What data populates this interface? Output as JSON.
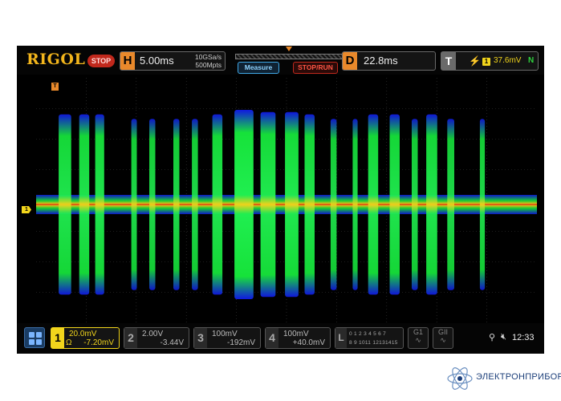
{
  "brand": {
    "logo_text": "RIGOL",
    "logo_color": "#f2b51c"
  },
  "status": {
    "run_state": "STOP",
    "run_state_color": "#c0281c"
  },
  "horizontal": {
    "letter": "H",
    "timebase": "5.00ms",
    "sample_rate": "10GSa/s",
    "memory_depth": "500Mpts"
  },
  "toolbar": {
    "measure_label": "Measure",
    "stop_run_label": "STOP/RUN"
  },
  "delay": {
    "letter": "D",
    "value": "22.8ms"
  },
  "trigger": {
    "letter": "T",
    "edge_icon": "rising-edge-icon",
    "source": "1",
    "level": "37.6mV",
    "mode": "N",
    "position_marker": "T"
  },
  "channel_marker": "1",
  "waveform": {
    "colors": {
      "low": "#1018e0",
      "mid": "#16e23a",
      "high": "#f0d21c",
      "peak": "#ff2010"
    },
    "bursts": [
      {
        "start": 0.045,
        "end": 0.07,
        "intensity": 0.8
      },
      {
        "start": 0.086,
        "end": 0.106,
        "intensity": 0.8
      },
      {
        "start": 0.118,
        "end": 0.136,
        "intensity": 0.8
      },
      {
        "start": 0.19,
        "end": 0.201,
        "intensity": 0.6
      },
      {
        "start": 0.226,
        "end": 0.238,
        "intensity": 0.6
      },
      {
        "start": 0.274,
        "end": 0.286,
        "intensity": 0.6
      },
      {
        "start": 0.311,
        "end": 0.323,
        "intensity": 0.6
      },
      {
        "start": 0.352,
        "end": 0.372,
        "intensity": 0.8
      },
      {
        "start": 0.396,
        "end": 0.434,
        "intensity": 1.0
      },
      {
        "start": 0.448,
        "end": 0.478,
        "intensity": 0.9
      },
      {
        "start": 0.497,
        "end": 0.524,
        "intensity": 0.9
      },
      {
        "start": 0.536,
        "end": 0.556,
        "intensity": 0.8
      },
      {
        "start": 0.588,
        "end": 0.6,
        "intensity": 0.6
      },
      {
        "start": 0.632,
        "end": 0.642,
        "intensity": 0.6
      },
      {
        "start": 0.663,
        "end": 0.683,
        "intensity": 0.8
      },
      {
        "start": 0.706,
        "end": 0.726,
        "intensity": 0.8
      },
      {
        "start": 0.75,
        "end": 0.762,
        "intensity": 0.6
      },
      {
        "start": 0.779,
        "end": 0.801,
        "intensity": 0.8
      },
      {
        "start": 0.821,
        "end": 0.835,
        "intensity": 0.6
      },
      {
        "start": 0.886,
        "end": 0.896,
        "intensity": 0.6
      }
    ]
  },
  "channels": [
    {
      "num": "1",
      "scale": "20.0mV",
      "coupling_symbol": "Ω",
      "offset": "-7.20mV",
      "active": true
    },
    {
      "num": "2",
      "scale": "2.00V",
      "offset": "-3.44V",
      "active": false
    },
    {
      "num": "3",
      "scale": "100mV",
      "offset": "-192mV",
      "active": false
    },
    {
      "num": "4",
      "scale": "100mV",
      "offset": "+40.0mV",
      "active": false
    }
  ],
  "logic": {
    "letter": "L",
    "row1": "0 1 2 3 4 5 6 7",
    "row2": "8 9 1011 12131415"
  },
  "decoders": [
    {
      "label": "G1"
    },
    {
      "label": "GII"
    }
  ],
  "system": {
    "usb_icon": "usb-icon",
    "volume_icon": "mute-icon",
    "time": "12:33"
  },
  "watermark": {
    "text": "ЭЛЕКТРОНПРИБОР",
    "color": "#1c3f7a"
  }
}
